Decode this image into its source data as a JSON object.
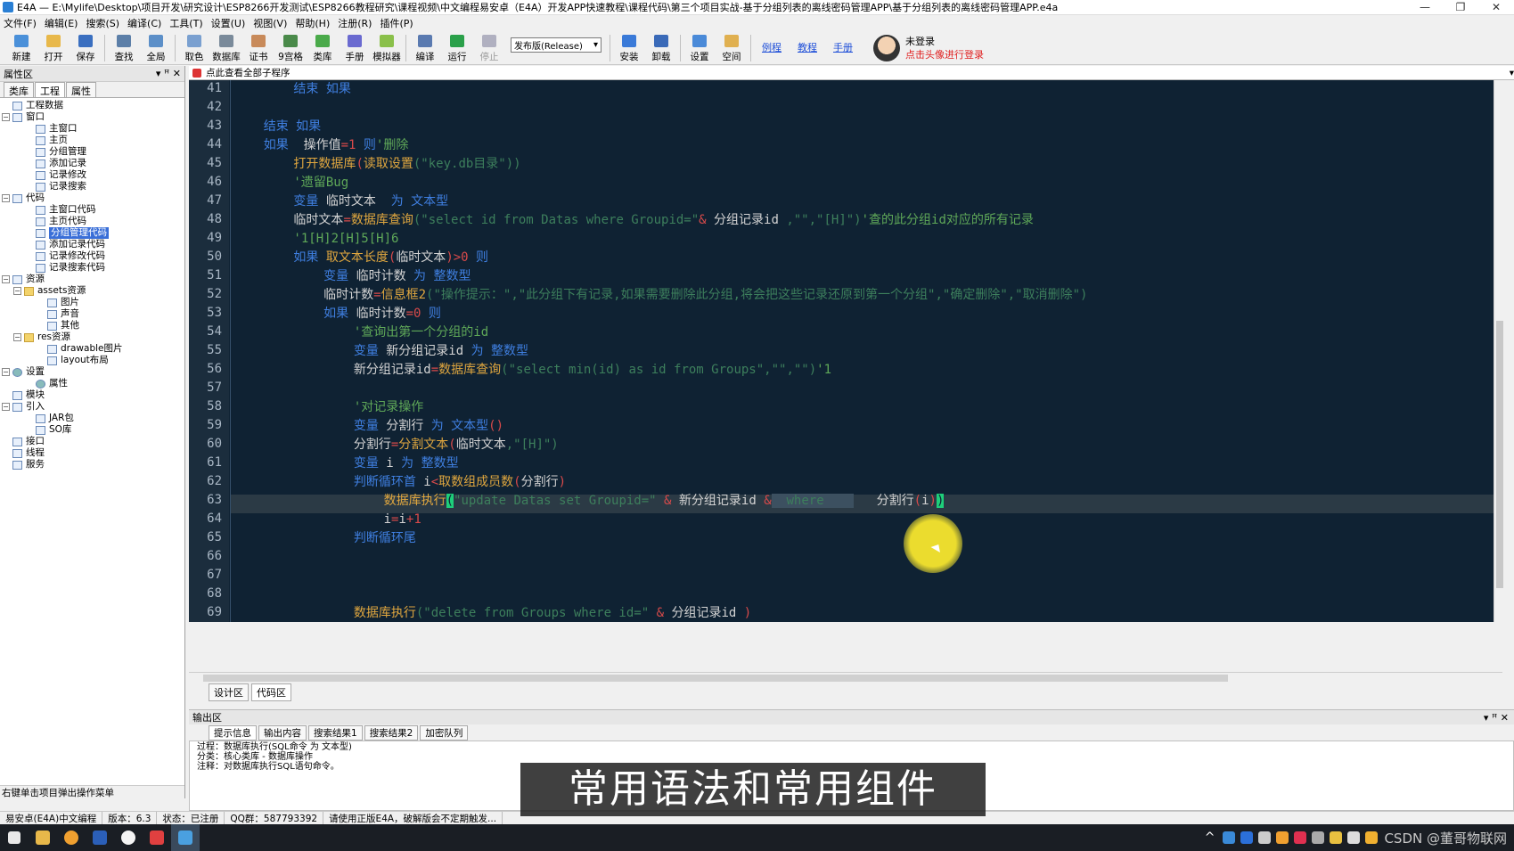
{
  "window": {
    "title": "E4A — E:\\Mylife\\Desktop\\项目开发\\研究设计\\ESP8266开发测试\\ESP8266教程研究\\课程视频\\中文编程易安卓（E4A）开发APP快速教程\\课程代码\\第三个项目实战-基于分组列表的离线密码管理APP\\基于分组列表的离线密码管理APP.e4a",
    "btn_min": "—",
    "btn_max": "❐",
    "btn_close": "✕"
  },
  "menu": [
    "文件(F)",
    "编辑(E)",
    "搜索(S)",
    "编译(C)",
    "工具(T)",
    "设置(U)",
    "视图(V)",
    "帮助(H)",
    "注册(R)",
    "插件(P)"
  ],
  "toolbar": {
    "buttons": [
      {
        "label": "新建",
        "icon": "new-file-icon",
        "color": "#4a90d9"
      },
      {
        "label": "打开",
        "icon": "open-folder-icon",
        "color": "#e8b84a"
      },
      {
        "label": "保存",
        "icon": "save-icon",
        "color": "#3a6fc0"
      },
      {
        "label": "查找",
        "icon": "search-icon",
        "color": "#5c7fa8"
      },
      {
        "label": "全局",
        "icon": "global-search-icon",
        "color": "#5c8fc8"
      },
      {
        "label": "取色",
        "icon": "color-picker-icon",
        "color": "#7aa0d0"
      },
      {
        "label": "数据库",
        "icon": "database-icon",
        "color": "#7a8a9a"
      },
      {
        "label": "证书",
        "icon": "certificate-icon",
        "color": "#c88a5a"
      },
      {
        "label": "9宫格",
        "icon": "grid-icon",
        "color": "#4a8a4a"
      },
      {
        "label": "类库",
        "icon": "library-icon",
        "color": "#4aaa4a"
      },
      {
        "label": "手册",
        "icon": "manual-icon",
        "color": "#6a6ad0"
      },
      {
        "label": "模拟器",
        "icon": "emulator-icon",
        "color": "#8ac04a"
      },
      {
        "label": "编译",
        "icon": "compile-icon",
        "color": "#5a7ab0"
      },
      {
        "label": "运行",
        "icon": "run-icon",
        "color": "#2aa04a"
      },
      {
        "label": "停止",
        "icon": "stop-icon",
        "color": "#b0b0c0",
        "disabled": true
      },
      {
        "label": "安装",
        "icon": "install-icon",
        "color": "#3a7ad8"
      },
      {
        "label": "卸载",
        "icon": "uninstall-icon",
        "color": "#3a6ab8"
      },
      {
        "label": "设置",
        "icon": "settings-icon",
        "color": "#4a8ad8"
      },
      {
        "label": "空间",
        "icon": "space-icon",
        "color": "#e0b050"
      }
    ],
    "release_select": "发布版(Release)",
    "links": [
      "例程",
      "教程",
      "手册"
    ],
    "login_line1": "未登录",
    "login_line2": "点击头像进行登录"
  },
  "prop_panel": {
    "title": "属性区",
    "pin": "ꟸ",
    "close": "✕",
    "tabs": [
      "类库",
      "工程",
      "属性"
    ],
    "tree": [
      {
        "label": "工程数据",
        "depth": 0,
        "exp": "",
        "icon": "project"
      },
      {
        "label": "窗口",
        "depth": 0,
        "exp": "−",
        "icon": "window"
      },
      {
        "label": "主窗口",
        "depth": 2,
        "exp": "",
        "icon": "window"
      },
      {
        "label": "主页",
        "depth": 2,
        "exp": "",
        "icon": "window"
      },
      {
        "label": "分组管理",
        "depth": 2,
        "exp": "",
        "icon": "window"
      },
      {
        "label": "添加记录",
        "depth": 2,
        "exp": "",
        "icon": "window"
      },
      {
        "label": "记录修改",
        "depth": 2,
        "exp": "",
        "icon": "window"
      },
      {
        "label": "记录搜索",
        "depth": 2,
        "exp": "",
        "icon": "window"
      },
      {
        "label": "代码",
        "depth": 0,
        "exp": "−",
        "icon": "code"
      },
      {
        "label": "主窗口代码",
        "depth": 2,
        "exp": "",
        "icon": "code"
      },
      {
        "label": "主页代码",
        "depth": 2,
        "exp": "",
        "icon": "code"
      },
      {
        "label": "分组管理代码",
        "depth": 2,
        "exp": "",
        "icon": "code",
        "selected": true
      },
      {
        "label": "添加记录代码",
        "depth": 2,
        "exp": "",
        "icon": "code"
      },
      {
        "label": "记录修改代码",
        "depth": 2,
        "exp": "",
        "icon": "code"
      },
      {
        "label": "记录搜索代码",
        "depth": 2,
        "exp": "",
        "icon": "code"
      },
      {
        "label": "资源",
        "depth": 0,
        "exp": "−",
        "icon": "resource"
      },
      {
        "label": "assets资源",
        "depth": 1,
        "exp": "−",
        "icon": "folder"
      },
      {
        "label": "图片",
        "depth": 3,
        "exp": "",
        "icon": "image"
      },
      {
        "label": "声音",
        "depth": 3,
        "exp": "",
        "icon": "sound"
      },
      {
        "label": "其他",
        "depth": 3,
        "exp": "",
        "icon": "other"
      },
      {
        "label": "res资源",
        "depth": 1,
        "exp": "−",
        "icon": "folder"
      },
      {
        "label": "drawable图片",
        "depth": 3,
        "exp": "",
        "icon": "image"
      },
      {
        "label": "layout布局",
        "depth": 3,
        "exp": "",
        "icon": "layout"
      },
      {
        "label": "设置",
        "depth": 0,
        "exp": "−",
        "icon": "gear"
      },
      {
        "label": "属性",
        "depth": 2,
        "exp": "",
        "icon": "gear"
      },
      {
        "label": "模块",
        "depth": 0,
        "exp": "",
        "icon": "module"
      },
      {
        "label": "引入",
        "depth": 0,
        "exp": "−",
        "icon": "import"
      },
      {
        "label": "JAR包",
        "depth": 2,
        "exp": "",
        "icon": "jar"
      },
      {
        "label": "SO库",
        "depth": 2,
        "exp": "",
        "icon": "so"
      },
      {
        "label": "接口",
        "depth": 0,
        "exp": "",
        "icon": "interface"
      },
      {
        "label": "线程",
        "depth": 0,
        "exp": "",
        "icon": "thread"
      },
      {
        "label": "服务",
        "depth": 0,
        "exp": "",
        "icon": "service"
      }
    ],
    "hint": "右键单击项目弹出操作菜单"
  },
  "editor": {
    "subroutine_hint": "点此查看全部子程序",
    "line_numbers": [
      "41",
      "42",
      "43",
      "44",
      "45",
      "46",
      "47",
      "48",
      "49",
      "50",
      "51",
      "52",
      "53",
      "54",
      "55",
      "56",
      "57",
      "58",
      "59",
      "60",
      "61",
      "62",
      "63",
      "64",
      "65",
      "66",
      "67",
      "68",
      "69"
    ],
    "lines": [
      [
        {
          "t": "        结束 如果",
          "c": "kw"
        }
      ],
      [],
      [
        {
          "t": "    结束 如果",
          "c": "kw"
        }
      ],
      [
        {
          "t": "    如果 ",
          "c": "kw"
        },
        {
          "t": " 操作值",
          "c": "tx"
        },
        {
          "t": "=1",
          "c": "num"
        },
        {
          "t": " 则",
          "c": "kw"
        },
        {
          "t": "'删除",
          "c": "cm"
        }
      ],
      [
        {
          "t": "        打开数据库",
          "c": "fn"
        },
        {
          "t": "(",
          "c": "op"
        },
        {
          "t": "读取设置",
          "c": "fn"
        },
        {
          "t": "(\"key.db目录\"))",
          "c": "str"
        }
      ],
      [
        {
          "t": "        '遗留Bug",
          "c": "cm"
        }
      ],
      [
        {
          "t": "        变量",
          "c": "kw"
        },
        {
          "t": " 临时文本  ",
          "c": "tx"
        },
        {
          "t": "为",
          "c": "kw"
        },
        {
          "t": " 文本型",
          "c": "kw"
        }
      ],
      [
        {
          "t": "        临时文本",
          "c": "tx"
        },
        {
          "t": "=",
          "c": "op"
        },
        {
          "t": "数据库查询",
          "c": "fn"
        },
        {
          "t": "(\"select id from Datas where Groupid=\"",
          "c": "str"
        },
        {
          "t": "&",
          "c": "op"
        },
        {
          "t": " 分组记录id ",
          "c": "tx"
        },
        {
          "t": ",\"\",\"[H]\")",
          "c": "str"
        },
        {
          "t": "'查的此分组id对应的所有记录",
          "c": "cm"
        }
      ],
      [
        {
          "t": "        '1[H]2[H]5[H]6",
          "c": "cm"
        }
      ],
      [
        {
          "t": "        如果",
          "c": "kw"
        },
        {
          "t": " 取文本长度",
          "c": "fn"
        },
        {
          "t": "(",
          "c": "op"
        },
        {
          "t": "临时文本",
          "c": "tx"
        },
        {
          "t": ")>0",
          "c": "num"
        },
        {
          "t": " 则",
          "c": "kw"
        }
      ],
      [
        {
          "t": "            变量",
          "c": "kw"
        },
        {
          "t": " 临时计数 ",
          "c": "tx"
        },
        {
          "t": "为",
          "c": "kw"
        },
        {
          "t": " 整数型",
          "c": "kw"
        }
      ],
      [
        {
          "t": "            临时计数",
          "c": "tx"
        },
        {
          "t": "=",
          "c": "op"
        },
        {
          "t": "信息框2",
          "c": "fn"
        },
        {
          "t": "(\"操作提示：\",\"此分组下有记录,如果需要删除此分组,将会把这些记录还原到第一个分组\",\"确定删除\",\"取消删除\")",
          "c": "str"
        }
      ],
      [
        {
          "t": "            如果",
          "c": "kw"
        },
        {
          "t": " 临时计数",
          "c": "tx"
        },
        {
          "t": "=0",
          "c": "num"
        },
        {
          "t": " 则",
          "c": "kw"
        }
      ],
      [
        {
          "t": "                '查询出第一个分组的id",
          "c": "cm"
        }
      ],
      [
        {
          "t": "                变量",
          "c": "kw"
        },
        {
          "t": " 新分组记录id ",
          "c": "tx"
        },
        {
          "t": "为",
          "c": "kw"
        },
        {
          "t": " 整数型",
          "c": "kw"
        }
      ],
      [
        {
          "t": "                新分组记录id",
          "c": "tx"
        },
        {
          "t": "=",
          "c": "op"
        },
        {
          "t": "数据库查询",
          "c": "fn"
        },
        {
          "t": "(\"select min(id) as id from Groups\",\"\",\"\")",
          "c": "str"
        },
        {
          "t": "'1",
          "c": "cm"
        }
      ],
      [],
      [
        {
          "t": "                '对记录操作",
          "c": "cm"
        }
      ],
      [
        {
          "t": "                变量",
          "c": "kw"
        },
        {
          "t": " 分割行 ",
          "c": "tx"
        },
        {
          "t": "为",
          "c": "kw"
        },
        {
          "t": " 文本型",
          "c": "kw"
        },
        {
          "t": "()",
          "c": "op"
        }
      ],
      [
        {
          "t": "                分割行",
          "c": "tx"
        },
        {
          "t": "=",
          "c": "op"
        },
        {
          "t": "分割文本",
          "c": "fn"
        },
        {
          "t": "(",
          "c": "op"
        },
        {
          "t": "临时文本",
          "c": "tx"
        },
        {
          "t": ",\"[H]\")",
          "c": "str"
        }
      ],
      [
        {
          "t": "                变量",
          "c": "kw"
        },
        {
          "t": " i ",
          "c": "tx"
        },
        {
          "t": "为",
          "c": "kw"
        },
        {
          "t": " 整数型",
          "c": "kw"
        }
      ],
      [
        {
          "t": "                判断循环首",
          "c": "kw"
        },
        {
          "t": " i",
          "c": "tx"
        },
        {
          "t": "<",
          "c": "op"
        },
        {
          "t": "取数组成员数",
          "c": "fn"
        },
        {
          "t": "(",
          "c": "op"
        },
        {
          "t": "分割行",
          "c": "tx"
        },
        {
          "t": ")",
          "c": "op"
        }
      ],
      [
        {
          "t": "                    数据库执行",
          "c": "fn"
        },
        {
          "t": "(",
          "c": "bracket"
        },
        {
          "t": "\"update Datas set Groupid=\" ",
          "c": "str"
        },
        {
          "t": "&",
          "c": "op"
        },
        {
          "t": " 新分组记录id ",
          "c": "tx"
        },
        {
          "t": "&",
          "c": "op"
        },
        {
          "t": "  where    ",
          "c": "selblk"
        },
        {
          "t": "   分割行",
          "c": "tx"
        },
        {
          "t": "(",
          "c": "op"
        },
        {
          "t": "i",
          "c": "tx"
        },
        {
          "t": ")",
          "c": "op"
        },
        {
          "t": ")",
          "c": "bracket"
        }
      ],
      [
        {
          "t": "                    i",
          "c": "tx"
        },
        {
          "t": "=",
          "c": "op"
        },
        {
          "t": "i",
          "c": "tx"
        },
        {
          "t": "+1",
          "c": "num"
        }
      ],
      [
        {
          "t": "                判断循环尾",
          "c": "kw"
        }
      ],
      [],
      [],
      [],
      [
        {
          "t": "                数据库执行",
          "c": "fn"
        },
        {
          "t": "(\"delete from Groups where id=\" ",
          "c": "str"
        },
        {
          "t": "&",
          "c": "op"
        },
        {
          "t": " 分组记录id ",
          "c": "tx"
        },
        {
          "t": ")",
          "c": "op"
        }
      ]
    ],
    "design_tab": "设计区",
    "code_tab": "代码区"
  },
  "output": {
    "title": "输出区",
    "tabs": [
      "提示信息",
      "输出内容",
      "搜索结果1",
      "搜索结果2",
      "加密队列"
    ],
    "line1": "过程：数据库执行(SQL命令 为 文本型)",
    "line2": "分类：核心类库 - 数据库操作",
    "line3": "注释：对数据库执行SQL语句命令。"
  },
  "status": {
    "app": "易安卓(E4A)中文编程",
    "version": "版本：6.3",
    "state": "状态：已注册",
    "qq": "QQ群：587793392",
    "tip": "请使用正版E4A，破解版会不定期触发..."
  },
  "subtitle": "常用语法和常用组件",
  "watermark": "CSDN @董哥物联网",
  "colors": {
    "editor_bg": "#0f2233",
    "keyword": "#3f7fe0",
    "function": "#e0a73f",
    "string": "#3d7f5c",
    "comment": "#5fa858"
  }
}
